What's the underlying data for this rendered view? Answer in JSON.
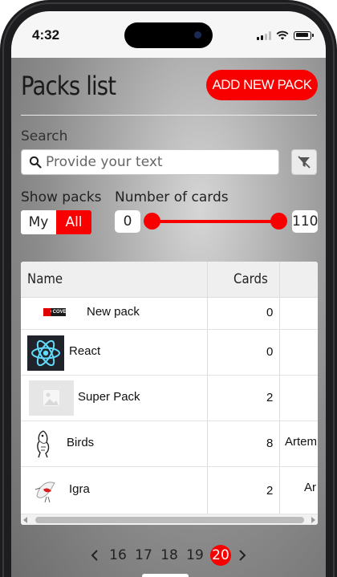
{
  "status_bar": {
    "time": "4:32"
  },
  "header": {
    "title": "Packs list",
    "add_button": "ADD NEW PACK"
  },
  "search": {
    "label": "Search",
    "placeholder": "Provide your text"
  },
  "filters": {
    "show_packs_label": "Show packs",
    "toggle_my": "My",
    "toggle_all": "All",
    "toggle_selected": "All",
    "cards_label": "Number of cards",
    "range_min": "0",
    "range_max": "110"
  },
  "table": {
    "columns": [
      "Name",
      "Cards"
    ],
    "rows": [
      {
        "name": "New pack",
        "cards": "0",
        "extra": "",
        "cover_text": "NO COVER"
      },
      {
        "name": "React",
        "cards": "0",
        "extra": ""
      },
      {
        "name": "Super Pack",
        "cards": "2",
        "extra": ""
      },
      {
        "name": "Birds",
        "cards": "8",
        "extra": "Artem"
      },
      {
        "name": "Igra",
        "cards": "2",
        "extra": "Ar"
      }
    ]
  },
  "pagination": {
    "pages": [
      "16",
      "17",
      "18",
      "19",
      "20"
    ],
    "current": "20"
  },
  "colors": {
    "accent": "#f90000",
    "react_bg": "#20232a",
    "react_logo": "#61dafb"
  }
}
